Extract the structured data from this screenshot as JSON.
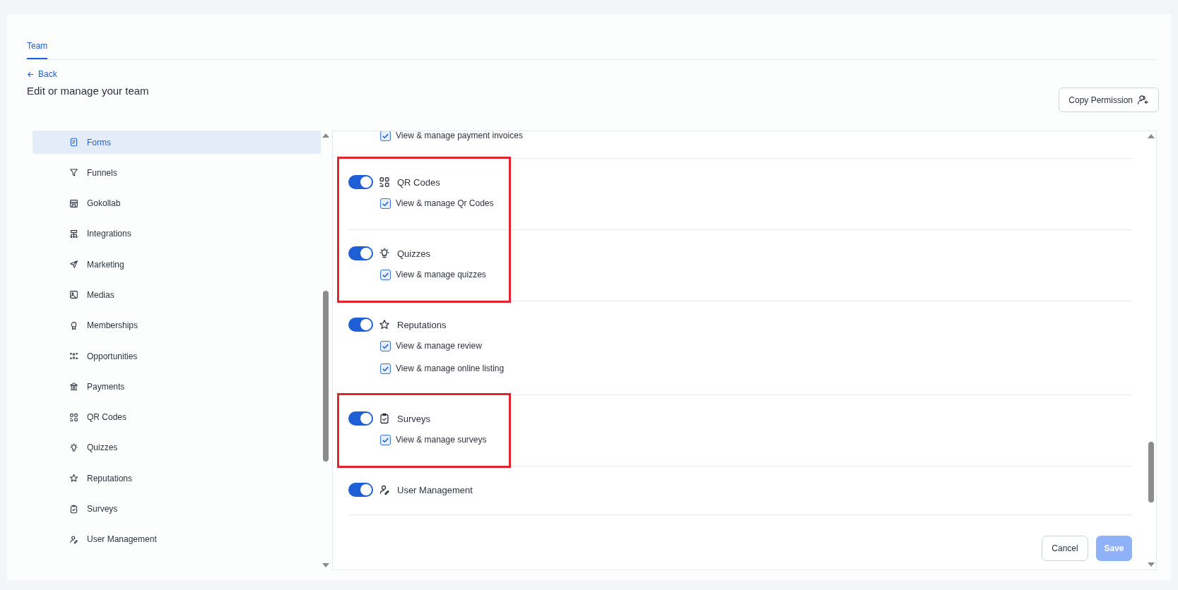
{
  "tabs": [
    {
      "label": "Team",
      "selected": true
    }
  ],
  "back_link": "Back",
  "title": "Edit or manage your team",
  "copy_button": "Copy Permission",
  "sidebar": {
    "items": [
      {
        "label": "Forms",
        "selected": true
      },
      {
        "label": "Funnels",
        "selected": false
      },
      {
        "label": "Gokollab",
        "selected": false
      },
      {
        "label": "Integrations",
        "selected": false
      },
      {
        "label": "Marketing",
        "selected": false
      },
      {
        "label": "Medias",
        "selected": false
      },
      {
        "label": "Memberships",
        "selected": false
      },
      {
        "label": "Opportunities",
        "selected": false
      },
      {
        "label": "Payments",
        "selected": false
      },
      {
        "label": "QR Codes",
        "selected": false
      },
      {
        "label": "Quizzes",
        "selected": false
      },
      {
        "label": "Reputations",
        "selected": false
      },
      {
        "label": "Surveys",
        "selected": false
      },
      {
        "label": "User Management",
        "selected": false
      }
    ]
  },
  "permissions": {
    "top_items": [
      {
        "label": "View & manage payment invoices",
        "checked": true
      }
    ],
    "blocks": [
      {
        "highlighted": true,
        "sections": [
          {
            "name": "QR Codes",
            "on": true,
            "items": [
              {
                "label": "View & manage Qr Codes",
                "checked": true
              }
            ]
          },
          {
            "name": "Quizzes",
            "on": true,
            "items": [
              {
                "label": "View & manage quizzes",
                "checked": true
              }
            ]
          }
        ]
      },
      {
        "highlighted": false,
        "sections": [
          {
            "name": "Reputations",
            "on": true,
            "items": [
              {
                "label": "View & manage review",
                "checked": true
              },
              {
                "label": "View & manage online listing",
                "checked": true
              }
            ]
          }
        ]
      },
      {
        "highlighted": true,
        "sections": [
          {
            "name": "Surveys",
            "on": true,
            "items": [
              {
                "label": "View & manage surveys",
                "checked": true
              }
            ]
          }
        ]
      },
      {
        "highlighted": false,
        "sections": [
          {
            "name": "User Management",
            "on": true
          }
        ]
      }
    ]
  },
  "buttons": {
    "cancel": "Cancel",
    "save": "Save",
    "save_disabled": true
  }
}
